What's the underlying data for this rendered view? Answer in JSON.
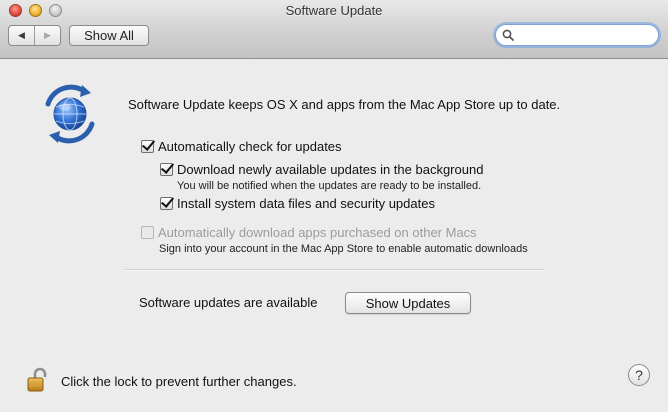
{
  "window": {
    "title": "Software Update"
  },
  "toolbar": {
    "back_icon": "back-arrow-icon",
    "forward_icon": "forward-arrow-icon",
    "show_all_label": "Show All",
    "search": {
      "value": "",
      "placeholder": ""
    }
  },
  "main": {
    "icon": "software-update-globe-icon",
    "intro_text": "Software Update keeps OS X and apps from the Mac App Store up to date.",
    "options": {
      "auto_check": {
        "label": "Automatically check for updates",
        "checked": true
      },
      "download_background": {
        "label": "Download newly available updates in the background",
        "checked": true,
        "note": "You will be notified when the updates are ready to be installed."
      },
      "install_system_data": {
        "label": "Install system data files and security updates",
        "checked": true
      },
      "auto_download_purchases": {
        "label": "Automatically download apps purchased on other Macs",
        "checked": false,
        "disabled": true,
        "note": "Sign into your account in the Mac App Store to enable automatic downloads"
      }
    },
    "status_text": "Software updates are available",
    "show_updates_label": "Show Updates"
  },
  "footer": {
    "lock_text": "Click the lock to prevent further changes.",
    "lock_icon": "unlocked-padlock-icon",
    "help_label": "?"
  },
  "colors": {
    "search_focus": "#7fa3d6",
    "globe_blue": "#2f6fd1"
  }
}
